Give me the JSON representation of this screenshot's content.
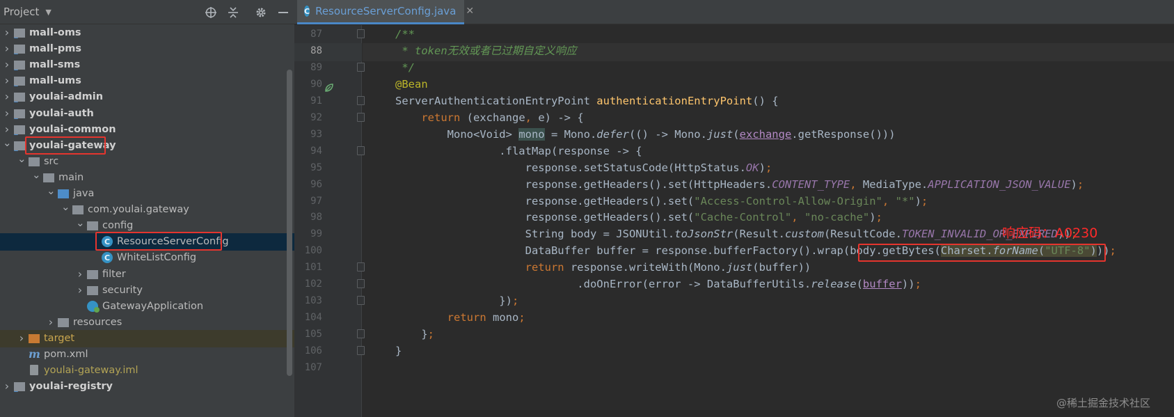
{
  "project_panel": {
    "title": "Project",
    "icons": [
      "locate-icon",
      "collapse-all-icon",
      "settings-gear-icon",
      "hide-minimize-icon"
    ],
    "tree": [
      {
        "label": "mall-oms",
        "depth": 0,
        "expanded": false,
        "icon": "module-folder-icon",
        "bold": true
      },
      {
        "label": "mall-pms",
        "depth": 0,
        "expanded": false,
        "icon": "module-folder-icon",
        "bold": true
      },
      {
        "label": "mall-sms",
        "depth": 0,
        "expanded": false,
        "icon": "module-folder-icon",
        "bold": true
      },
      {
        "label": "mall-ums",
        "depth": 0,
        "expanded": false,
        "icon": "module-folder-icon",
        "bold": true
      },
      {
        "label": "youlai-admin",
        "depth": 0,
        "expanded": false,
        "icon": "module-folder-icon",
        "bold": true
      },
      {
        "label": "youlai-auth",
        "depth": 0,
        "expanded": false,
        "icon": "module-folder-icon",
        "bold": true
      },
      {
        "label": "youlai-common",
        "depth": 0,
        "expanded": false,
        "icon": "module-folder-icon",
        "bold": true
      },
      {
        "label": "youlai-gateway",
        "depth": 0,
        "expanded": true,
        "icon": "module-folder-icon",
        "bold": true,
        "highlighted": true
      },
      {
        "label": "src",
        "depth": 1,
        "expanded": true,
        "icon": "folder-icon"
      },
      {
        "label": "main",
        "depth": 2,
        "expanded": true,
        "icon": "folder-icon"
      },
      {
        "label": "java",
        "depth": 3,
        "expanded": true,
        "icon": "source-folder-icon"
      },
      {
        "label": "com.youlai.gateway",
        "depth": 4,
        "expanded": true,
        "icon": "package-icon"
      },
      {
        "label": "config",
        "depth": 5,
        "expanded": true,
        "icon": "package-icon"
      },
      {
        "label": "ResourceServerConfig",
        "depth": 6,
        "icon": "java-class-icon",
        "selected": true,
        "highlighted": true
      },
      {
        "label": "WhiteListConfig",
        "depth": 6,
        "icon": "java-class-icon"
      },
      {
        "label": "filter",
        "depth": 5,
        "expanded": false,
        "icon": "package-icon"
      },
      {
        "label": "security",
        "depth": 5,
        "expanded": false,
        "icon": "package-icon"
      },
      {
        "label": "GatewayApplication",
        "depth": 5,
        "icon": "spring-boot-class-icon"
      },
      {
        "label": "resources",
        "depth": 3,
        "expanded": false,
        "icon": "resources-folder-icon"
      },
      {
        "label": "target",
        "depth": 1,
        "expanded": false,
        "icon": "excluded-folder-icon",
        "excluded": true
      },
      {
        "label": "pom.xml",
        "depth": 1,
        "icon": "maven-icon"
      },
      {
        "label": "youlai-gateway.iml",
        "depth": 1,
        "icon": "iml-file-icon",
        "yellow": true
      },
      {
        "label": "youlai-registry",
        "depth": 0,
        "expanded": false,
        "icon": "module-folder-icon",
        "bold": true
      }
    ]
  },
  "editor": {
    "tab": {
      "label": "ResourceServerConfig.java",
      "close": "✕"
    },
    "current_line": 88,
    "lines": [
      {
        "n": "87",
        "fold": true,
        "html": "<span class=\"c\">/**</span>"
      },
      {
        "n": "88",
        "html": "<span class=\"c\"> * token无效或者已过期自定义响应</span>"
      },
      {
        "n": "89",
        "fold": true,
        "html": "<span class=\"c\"> */</span>"
      },
      {
        "n": "90",
        "bean": true,
        "html": "<span class=\"an\">@Bean</span>"
      },
      {
        "n": "91",
        "fold": true,
        "html": "ServerAuthenticationEntryPoint <span class=\"fn\">authenticationEntryPoint</span>() {"
      },
      {
        "n": "92",
        "fold": true,
        "html": "    <span class=\"k\">return</span> (exchange<span class=\"k\">,</span> e) -> {"
      },
      {
        "n": "93",
        "html": "        Mono&lt;Void&gt; <span class=\"hl-mono\">mono</span> = Mono.<span class=\"it\">defer</span>(() -> Mono.<span class=\"it\">just</span>(<span class=\"pu\">exchange</span>.getResponse()))"
      },
      {
        "n": "94",
        "fold": true,
        "html": "                .flatMap(response -> {"
      },
      {
        "n": "95",
        "html": "                    response.setStatusCode(HttpStatus.<span class=\"cn\">OK</span>)<span class=\"k\">;</span>"
      },
      {
        "n": "96",
        "html": "                    response.getHeaders().set(HttpHeaders.<span class=\"cn\">CONTENT_TYPE</span><span class=\"k\">,</span> MediaType.<span class=\"cn\">APPLICATION_JSON_VALUE</span>)<span class=\"k\">;</span>"
      },
      {
        "n": "97",
        "html": "                    response.getHeaders().set(<span class=\"st\">\"Access-Control-Allow-Origin\"</span><span class=\"k\">,</span> <span class=\"st\">\"*\"</span>)<span class=\"k\">;</span>"
      },
      {
        "n": "98",
        "html": "                    response.getHeaders().set(<span class=\"st\">\"Cache-Control\"</span><span class=\"k\">,</span> <span class=\"st\">\"no-cache\"</span>)<span class=\"k\">;</span>"
      },
      {
        "n": "99",
        "html": "                    String body = JSONUtil.<span class=\"it\">toJsonStr</span>(Result.<span class=\"it\">custom</span>(ResultCode.<span class=\"cn\">TOKEN_INVALID_OR_EXPIRED</span>))<span class=\"k\">;</span>"
      },
      {
        "n": "100",
        "html": "                    DataBuffer buffer = response.bufferFactory().wrap(body.getBytes(<span class=\"hl-warn\">Charset.<span class=\"it\">forName</span>(<span class=\"st\">\"UTF-8\"</span>)</span>))<span class=\"k\">;</span>"
      },
      {
        "n": "101",
        "fold": true,
        "html": "                    <span class=\"k\">return</span> response.writeWith(Mono.<span class=\"it\">just</span>(buffer))"
      },
      {
        "n": "102",
        "fold": true,
        "html": "                            .doOnError(error -> DataBufferUtils.<span class=\"it\">release</span>(<span class=\"pu\">buffer</span>))<span class=\"k\">;</span>"
      },
      {
        "n": "103",
        "fold": true,
        "html": "                })<span class=\"k\">;</span>"
      },
      {
        "n": "104",
        "html": "        <span class=\"k\">return</span> mono<span class=\"k\">;</span>"
      },
      {
        "n": "105",
        "fold": true,
        "html": "    }<span class=\"k\">;</span>"
      },
      {
        "n": "106",
        "fold": true,
        "html": "}"
      },
      {
        "n": "107",
        "html": ""
      }
    ]
  },
  "annotation": "响应码：A0230",
  "watermark": "@稀土掘金技术社区"
}
